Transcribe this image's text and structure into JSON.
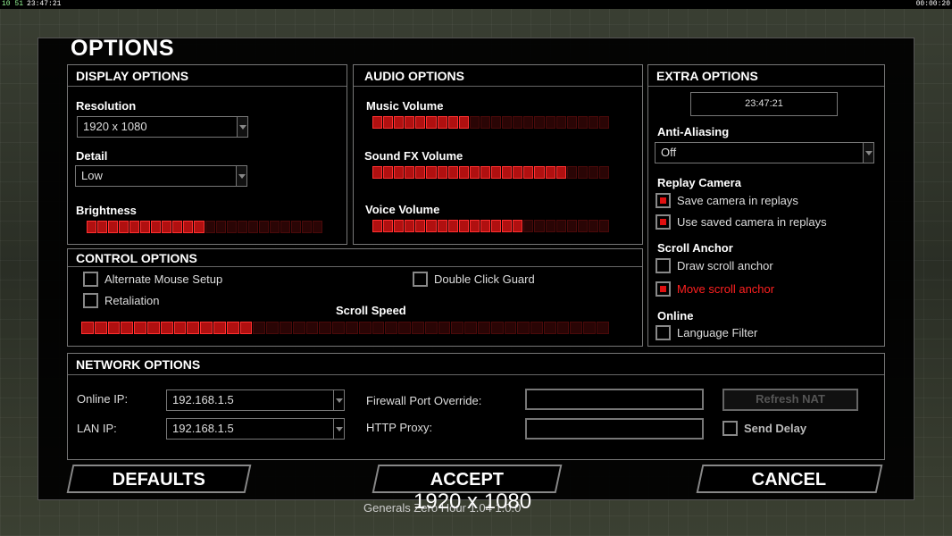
{
  "topbar": {
    "left_status": "10 51",
    "left_clock": "23:47:21",
    "right_clock": "00:00:20"
  },
  "title": "OPTIONS",
  "display": {
    "header": "DISPLAY OPTIONS",
    "resolution_label": "Resolution",
    "resolution_value": "1920 x 1080",
    "detail_label": "Detail",
    "detail_value": "Low",
    "brightness_label": "Brightness",
    "brightness_level": 0.5
  },
  "audio": {
    "header": "AUDIO OPTIONS",
    "music_label": "Music Volume",
    "music_level": 0.41,
    "sfx_label": "Sound FX Volume",
    "sfx_level": 0.8,
    "voice_label": "Voice Volume",
    "voice_level": 0.63
  },
  "extra": {
    "header": "EXTRA OPTIONS",
    "clock": "23:47:21",
    "aa_label": "Anti-Aliasing",
    "aa_value": "Off",
    "replay_label": "Replay Camera",
    "save_camera": "Save camera in replays",
    "use_camera": "Use saved camera in replays",
    "scroll_anchor_label": "Scroll Anchor",
    "draw_anchor": "Draw scroll anchor",
    "move_anchor": "Move scroll anchor",
    "online_label": "Online",
    "language_filter": "Language Filter"
  },
  "control": {
    "header": "CONTROL OPTIONS",
    "alt_mouse": "Alternate Mouse Setup",
    "retaliation": "Retaliation",
    "double_click": "Double Click Guard",
    "scroll_speed_label": "Scroll Speed",
    "scroll_level": 0.32
  },
  "network": {
    "header": "NETWORK OPTIONS",
    "online_ip_label": "Online IP:",
    "online_ip": "192.168.1.5",
    "lan_ip_label": "LAN IP:",
    "lan_ip": "192.168.1.5",
    "firewall_label": "Firewall Port Override:",
    "proxy_label": "HTTP Proxy:",
    "refresh_nat": "Refresh NAT",
    "send_delay": "Send Delay"
  },
  "buttons": {
    "defaults": "DEFAULTS",
    "accept": "ACCEPT",
    "cancel": "CANCEL"
  },
  "footer": {
    "resolution": "1920 x 1080",
    "version": "Generals Zero Hour 1.04 1.0.0"
  },
  "colors": {
    "slider_on": "#b01010",
    "checkbox_on": "#e01010",
    "highlight_text": "#ff2020"
  }
}
